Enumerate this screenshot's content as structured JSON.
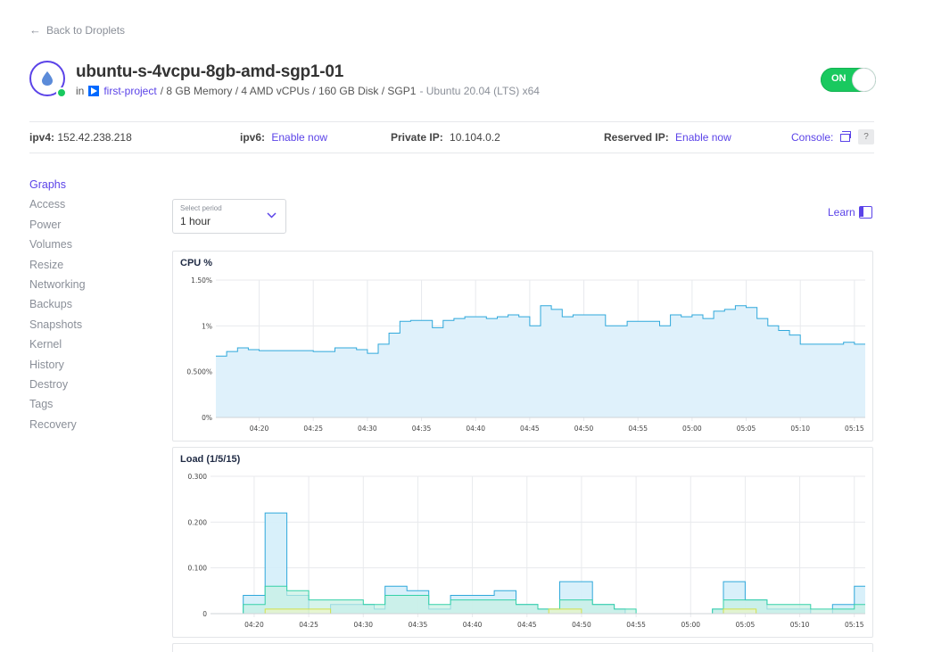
{
  "back": {
    "label": "Back to Droplets"
  },
  "droplet": {
    "name": "ubuntu-s-4vcpu-8gb-amd-sgp1-01",
    "in_label": "in",
    "project": "first-project",
    "specs": "/ 8 GB Memory / 4 AMD vCPUs / 160 GB Disk / SGP1",
    "os": "- Ubuntu 20.04 (LTS) x64",
    "power_state": "ON"
  },
  "network": {
    "ipv4_label": "ipv4:",
    "ipv4_value": "152.42.238.218",
    "ipv6_label": "ipv6:",
    "ipv6_link": "Enable now",
    "private_label": "Private IP:",
    "private_value": "10.104.0.2",
    "reserved_label": "Reserved IP:",
    "reserved_link": "Enable now",
    "console_label": "Console:",
    "help_label": "?"
  },
  "sidebar": {
    "items": [
      {
        "label": "Graphs",
        "active": true
      },
      {
        "label": "Access"
      },
      {
        "label": "Power"
      },
      {
        "label": "Volumes"
      },
      {
        "label": "Resize"
      },
      {
        "label": "Networking"
      },
      {
        "label": "Backups"
      },
      {
        "label": "Snapshots"
      },
      {
        "label": "Kernel"
      },
      {
        "label": "History"
      },
      {
        "label": "Destroy"
      },
      {
        "label": "Tags"
      },
      {
        "label": "Recovery"
      }
    ]
  },
  "period": {
    "label": "Select period",
    "value": "1 hour"
  },
  "learn": {
    "label": "Learn"
  },
  "colors": {
    "accent": "#5b43e8",
    "on_green": "#19c95f",
    "cpu_line": "#2fa8db",
    "cpu_fill": "#dff1fb"
  },
  "chart_data": [
    {
      "type": "area",
      "title": "CPU %",
      "x_ticks": [
        "04:20",
        "04:25",
        "04:30",
        "04:35",
        "04:40",
        "04:45",
        "04:50",
        "04:55",
        "05:00",
        "05:05",
        "05:10",
        "05:15"
      ],
      "y_ticks": [
        "1.50%",
        "1%",
        "0.500%",
        "0%"
      ],
      "ylim": [
        0,
        1.5
      ],
      "grid": true,
      "series": [
        {
          "x": [
            "04:16",
            "04:17",
            "04:18",
            "04:19",
            "04:20",
            "04:21",
            "04:22",
            "04:23",
            "04:24",
            "04:25",
            "04:26",
            "04:27",
            "04:28",
            "04:29",
            "04:30",
            "04:31",
            "04:32",
            "04:33",
            "04:34",
            "04:35",
            "04:36",
            "04:37",
            "04:38",
            "04:39",
            "04:40",
            "04:41",
            "04:42",
            "04:43",
            "04:44",
            "04:45",
            "04:46",
            "04:47",
            "04:48",
            "04:49",
            "04:50",
            "04:51",
            "04:52",
            "04:53",
            "04:54",
            "04:55",
            "04:56",
            "04:57",
            "04:58",
            "04:59",
            "05:00",
            "05:01",
            "05:02",
            "05:03",
            "05:04",
            "05:05",
            "05:06",
            "05:07",
            "05:08",
            "05:09",
            "05:10",
            "05:11",
            "05:12",
            "05:13",
            "05:14",
            "05:15"
          ],
          "values": [
            0.67,
            0.72,
            0.76,
            0.74,
            0.73,
            0.73,
            0.73,
            0.73,
            0.73,
            0.72,
            0.72,
            0.76,
            0.76,
            0.74,
            0.7,
            0.8,
            0.92,
            1.05,
            1.06,
            1.06,
            0.98,
            1.06,
            1.08,
            1.1,
            1.1,
            1.08,
            1.1,
            1.12,
            1.1,
            1.0,
            1.22,
            1.18,
            1.1,
            1.12,
            1.12,
            1.12,
            1.0,
            1.0,
            1.05,
            1.05,
            1.05,
            1.0,
            1.12,
            1.1,
            1.12,
            1.08,
            1.16,
            1.18,
            1.22,
            1.2,
            1.08,
            1.0,
            0.95,
            0.9,
            0.8,
            0.8,
            0.8,
            0.8,
            0.82,
            0.8
          ]
        }
      ]
    },
    {
      "type": "area",
      "title": "Load (1/5/15)",
      "x_ticks": [
        "04:20",
        "04:25",
        "04:30",
        "04:35",
        "04:40",
        "04:45",
        "04:50",
        "04:55",
        "05:00",
        "05:05",
        "05:10",
        "05:15"
      ],
      "y_ticks": [
        "0.300",
        "0.200",
        "0.100",
        "0"
      ],
      "ylim": [
        0,
        0.3
      ],
      "grid": true,
      "series": [
        {
          "x": [
            "04:16",
            "04:17",
            "04:18",
            "04:19",
            "04:20",
            "04:21",
            "04:22",
            "04:23",
            "04:24",
            "04:25",
            "04:26",
            "04:27",
            "04:28",
            "04:29",
            "04:30",
            "04:31",
            "04:32",
            "04:33",
            "04:34",
            "04:35",
            "04:36",
            "04:37",
            "04:38",
            "04:39",
            "04:40",
            "04:41",
            "04:42",
            "04:43",
            "04:44",
            "04:45",
            "04:46",
            "04:47",
            "04:48",
            "04:49",
            "04:50",
            "04:51",
            "04:52",
            "04:53",
            "04:54",
            "04:55",
            "04:56",
            "04:57",
            "04:58",
            "04:59",
            "05:00",
            "05:01",
            "05:02",
            "05:03",
            "05:04",
            "05:05",
            "05:06",
            "05:07",
            "05:08",
            "05:09",
            "05:10",
            "05:11",
            "05:12",
            "05:13",
            "05:14",
            "05:15"
          ],
          "values": [
            0,
            0,
            0,
            0.04,
            0.04,
            0.22,
            0.22,
            0.04,
            0.04,
            0,
            0,
            0.02,
            0.02,
            0.02,
            0.02,
            0.01,
            0.06,
            0.06,
            0.05,
            0.05,
            0.01,
            0.01,
            0.04,
            0.04,
            0.04,
            0.04,
            0.05,
            0.05,
            0.02,
            0.02,
            0.01,
            0.01,
            0.07,
            0.07,
            0.07,
            0.02,
            0.02,
            0.01,
            0,
            0,
            0,
            0,
            0,
            0,
            0,
            0,
            0.01,
            0.07,
            0.07,
            0.03,
            0.03,
            0.01,
            0.01,
            0.01,
            0.01,
            0,
            0,
            0.02,
            0.02,
            0.06
          ]
        },
        {
          "x": [
            "04:16",
            "04:17",
            "04:18",
            "04:19",
            "04:20",
            "04:21",
            "04:22",
            "04:23",
            "04:24",
            "04:25",
            "04:26",
            "04:27",
            "04:28",
            "04:29",
            "04:30",
            "04:31",
            "04:32",
            "04:33",
            "04:34",
            "04:35",
            "04:36",
            "04:37",
            "04:38",
            "04:39",
            "04:40",
            "04:41",
            "04:42",
            "04:43",
            "04:44",
            "04:45",
            "04:46",
            "04:47",
            "04:48",
            "04:49",
            "04:50",
            "04:51",
            "04:52",
            "04:53",
            "04:54",
            "04:55",
            "04:56",
            "04:57",
            "04:58",
            "04:59",
            "05:00",
            "05:01",
            "05:02",
            "05:03",
            "05:04",
            "05:05",
            "05:06",
            "05:07",
            "05:08",
            "05:09",
            "05:10",
            "05:11",
            "05:12",
            "05:13",
            "05:14",
            "05:15"
          ],
          "values": [
            0,
            0,
            0,
            0.02,
            0.02,
            0.06,
            0.06,
            0.05,
            0.05,
            0.03,
            0.03,
            0.03,
            0.03,
            0.03,
            0.02,
            0.02,
            0.04,
            0.04,
            0.04,
            0.04,
            0.02,
            0.02,
            0.03,
            0.03,
            0.03,
            0.03,
            0.03,
            0.03,
            0.02,
            0.02,
            0.01,
            0.01,
            0.03,
            0.03,
            0.03,
            0.02,
            0.02,
            0.01,
            0.01,
            0,
            0,
            0,
            0,
            0,
            0,
            0,
            0.01,
            0.03,
            0.03,
            0.03,
            0.03,
            0.02,
            0.02,
            0.02,
            0.02,
            0.01,
            0.01,
            0.01,
            0.01,
            0.02
          ]
        },
        {
          "x": [
            "04:16",
            "04:17",
            "04:18",
            "04:19",
            "04:20",
            "04:21",
            "04:22",
            "04:23",
            "04:24",
            "04:25",
            "04:26",
            "04:27",
            "04:28",
            "04:29",
            "04:30",
            "04:31",
            "04:32",
            "04:33",
            "04:34",
            "04:35",
            "04:36",
            "04:37",
            "04:38",
            "04:39",
            "04:40",
            "04:41",
            "04:42",
            "04:43",
            "04:44",
            "04:45",
            "04:46",
            "04:47",
            "04:48",
            "04:49",
            "04:50",
            "04:51",
            "04:52",
            "04:53",
            "04:54",
            "04:55",
            "04:56",
            "04:57",
            "04:58",
            "04:59",
            "05:00",
            "05:01",
            "05:02",
            "05:03",
            "05:04",
            "05:05",
            "05:06",
            "05:07",
            "05:08",
            "05:09",
            "05:10",
            "05:11",
            "05:12",
            "05:13",
            "05:14",
            "05:15"
          ],
          "values": [
            0,
            0,
            0,
            0,
            0,
            0.01,
            0.01,
            0.01,
            0.01,
            0.01,
            0.01,
            0,
            0,
            0,
            0,
            0,
            0,
            0,
            0,
            0,
            0,
            0,
            0,
            0,
            0,
            0,
            0,
            0,
            0,
            0,
            0,
            0.01,
            0.01,
            0.01,
            0,
            0,
            0,
            0,
            0,
            0,
            0,
            0,
            0,
            0,
            0,
            0,
            0,
            0.01,
            0.01,
            0.01,
            0,
            0,
            0,
            0,
            0,
            0,
            0,
            0,
            0,
            0
          ]
        }
      ]
    }
  ]
}
